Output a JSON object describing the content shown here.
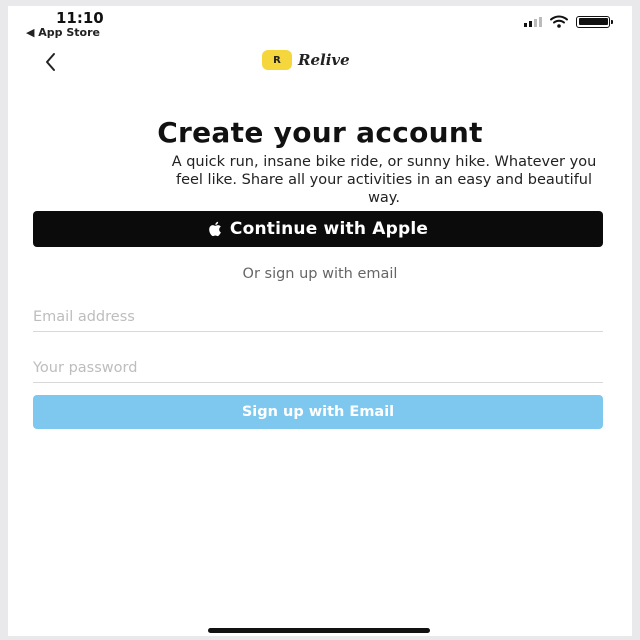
{
  "status_bar": {
    "time": "11:10",
    "back_app": "◀ App Store",
    "icons": [
      "signal-icon",
      "wifi-icon",
      "battery-icon"
    ]
  },
  "nav": {
    "back_icon": "chevron-left-icon",
    "logo_badge": "R",
    "logo_text": "Relive",
    "brand_color": "#f5d63c"
  },
  "content": {
    "title": "Create your account",
    "subtitle": "A quick run, insane bike ride, or sunny hike. Whatever you feel like. Share all your activities in an easy and beautiful way.",
    "apple_button_label": "Continue with Apple",
    "apple_icon": "apple-icon",
    "or_text": "Or sign up with email",
    "email_placeholder": "Email address",
    "email_value": "",
    "password_placeholder": "Your password",
    "password_value": "",
    "signup_button_label": "Sign up with Email",
    "signup_button_color": "#7ec8ef"
  }
}
